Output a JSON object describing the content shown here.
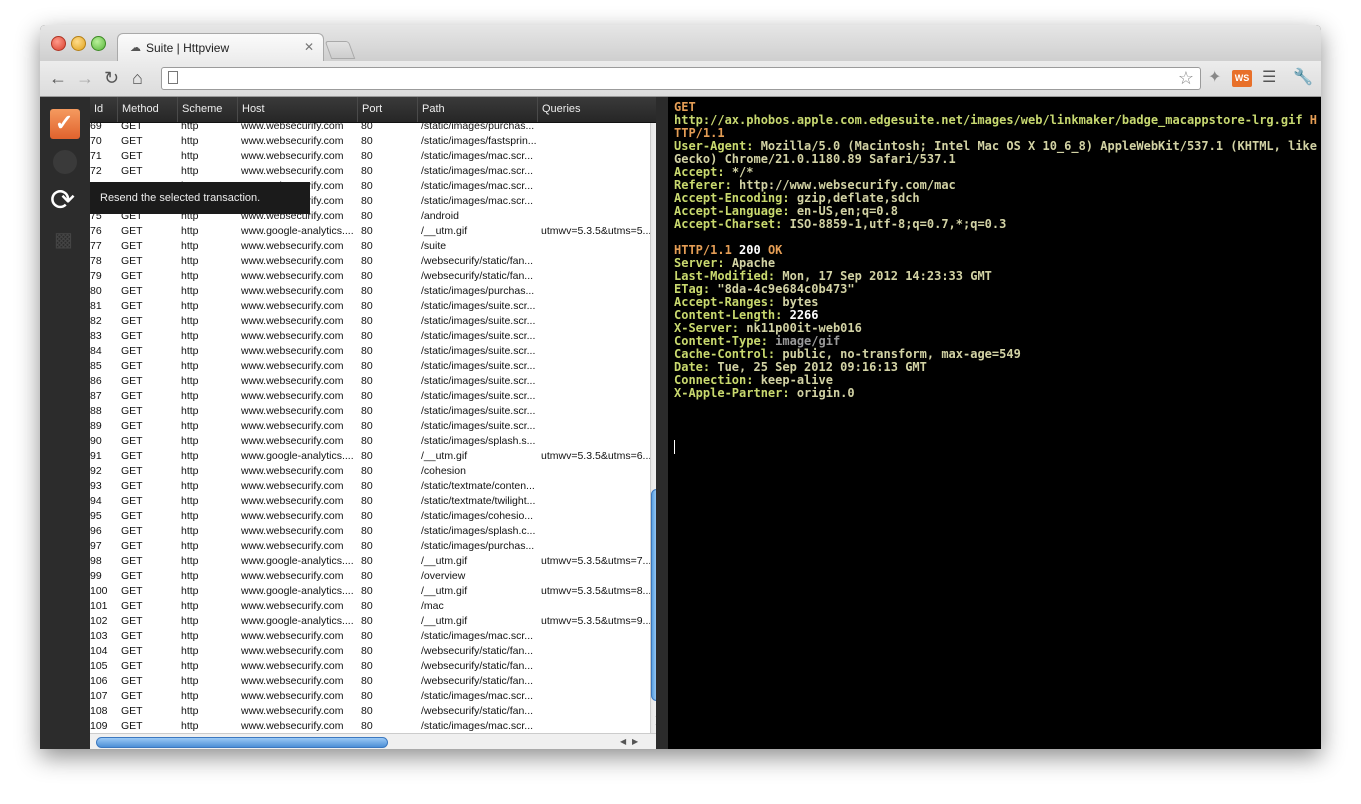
{
  "browser": {
    "tab_title": "Suite | Httpview",
    "tab_close": "✕",
    "url": "",
    "ext_ws_label": "WS"
  },
  "tooltip": "Resend the selected transaction.",
  "grid": {
    "columns": [
      "Id",
      "Method",
      "Scheme",
      "Host",
      "Port",
      "Path",
      "Queries"
    ],
    "rows": [
      [
        "69",
        "GET",
        "http",
        "www.websecurify.com",
        "80",
        "/static/images/purchas...",
        ""
      ],
      [
        "70",
        "GET",
        "http",
        "www.websecurify.com",
        "80",
        "/static/images/fastsprin...",
        ""
      ],
      [
        "71",
        "GET",
        "http",
        "www.websecurify.com",
        "80",
        "/static/images/mac.scr...",
        ""
      ],
      [
        "72",
        "GET",
        "http",
        "www.websecurify.com",
        "80",
        "/static/images/mac.scr...",
        ""
      ],
      [
        "73",
        "GET",
        "http",
        "www.websecurify.com",
        "80",
        "/static/images/mac.scr...",
        ""
      ],
      [
        "74",
        "GET",
        "http",
        "www.websecurify.com",
        "80",
        "/static/images/mac.scr...",
        ""
      ],
      [
        "75",
        "GET",
        "http",
        "www.websecurify.com",
        "80",
        "/android",
        ""
      ],
      [
        "76",
        "GET",
        "http",
        "www.google-analytics....",
        "80",
        "/__utm.gif",
        "utmwv=5.3.5&utms=5..."
      ],
      [
        "77",
        "GET",
        "http",
        "www.websecurify.com",
        "80",
        "/suite",
        ""
      ],
      [
        "78",
        "GET",
        "http",
        "www.websecurify.com",
        "80",
        "/websecurify/static/fan...",
        ""
      ],
      [
        "79",
        "GET",
        "http",
        "www.websecurify.com",
        "80",
        "/websecurify/static/fan...",
        ""
      ],
      [
        "80",
        "GET",
        "http",
        "www.websecurify.com",
        "80",
        "/static/images/purchas...",
        ""
      ],
      [
        "81",
        "GET",
        "http",
        "www.websecurify.com",
        "80",
        "/static/images/suite.scr...",
        ""
      ],
      [
        "82",
        "GET",
        "http",
        "www.websecurify.com",
        "80",
        "/static/images/suite.scr...",
        ""
      ],
      [
        "83",
        "GET",
        "http",
        "www.websecurify.com",
        "80",
        "/static/images/suite.scr...",
        ""
      ],
      [
        "84",
        "GET",
        "http",
        "www.websecurify.com",
        "80",
        "/static/images/suite.scr...",
        ""
      ],
      [
        "85",
        "GET",
        "http",
        "www.websecurify.com",
        "80",
        "/static/images/suite.scr...",
        ""
      ],
      [
        "86",
        "GET",
        "http",
        "www.websecurify.com",
        "80",
        "/static/images/suite.scr...",
        ""
      ],
      [
        "87",
        "GET",
        "http",
        "www.websecurify.com",
        "80",
        "/static/images/suite.scr...",
        ""
      ],
      [
        "88",
        "GET",
        "http",
        "www.websecurify.com",
        "80",
        "/static/images/suite.scr...",
        ""
      ],
      [
        "89",
        "GET",
        "http",
        "www.websecurify.com",
        "80",
        "/static/images/suite.scr...",
        ""
      ],
      [
        "90",
        "GET",
        "http",
        "www.websecurify.com",
        "80",
        "/static/images/splash.s...",
        ""
      ],
      [
        "91",
        "GET",
        "http",
        "www.google-analytics....",
        "80",
        "/__utm.gif",
        "utmwv=5.3.5&utms=6..."
      ],
      [
        "92",
        "GET",
        "http",
        "www.websecurify.com",
        "80",
        "/cohesion",
        ""
      ],
      [
        "93",
        "GET",
        "http",
        "www.websecurify.com",
        "80",
        "/static/textmate/conten...",
        ""
      ],
      [
        "94",
        "GET",
        "http",
        "www.websecurify.com",
        "80",
        "/static/textmate/twilight...",
        ""
      ],
      [
        "95",
        "GET",
        "http",
        "www.websecurify.com",
        "80",
        "/static/images/cohesio...",
        ""
      ],
      [
        "96",
        "GET",
        "http",
        "www.websecurify.com",
        "80",
        "/static/images/splash.c...",
        ""
      ],
      [
        "97",
        "GET",
        "http",
        "www.websecurify.com",
        "80",
        "/static/images/purchas...",
        ""
      ],
      [
        "98",
        "GET",
        "http",
        "www.google-analytics....",
        "80",
        "/__utm.gif",
        "utmwv=5.3.5&utms=7..."
      ],
      [
        "99",
        "GET",
        "http",
        "www.websecurify.com",
        "80",
        "/overview",
        ""
      ],
      [
        "100",
        "GET",
        "http",
        "www.google-analytics....",
        "80",
        "/__utm.gif",
        "utmwv=5.3.5&utms=8..."
      ],
      [
        "101",
        "GET",
        "http",
        "www.websecurify.com",
        "80",
        "/mac",
        ""
      ],
      [
        "102",
        "GET",
        "http",
        "www.google-analytics....",
        "80",
        "/__utm.gif",
        "utmwv=5.3.5&utms=9..."
      ],
      [
        "103",
        "GET",
        "http",
        "www.websecurify.com",
        "80",
        "/static/images/mac.scr...",
        ""
      ],
      [
        "104",
        "GET",
        "http",
        "www.websecurify.com",
        "80",
        "/websecurify/static/fan...",
        ""
      ],
      [
        "105",
        "GET",
        "http",
        "www.websecurify.com",
        "80",
        "/websecurify/static/fan...",
        ""
      ],
      [
        "106",
        "GET",
        "http",
        "www.websecurify.com",
        "80",
        "/websecurify/static/fan...",
        ""
      ],
      [
        "107",
        "GET",
        "http",
        "www.websecurify.com",
        "80",
        "/static/images/mac.scr...",
        ""
      ],
      [
        "108",
        "GET",
        "http",
        "www.websecurify.com",
        "80",
        "/websecurify/static/fan...",
        ""
      ],
      [
        "109",
        "GET",
        "http",
        "www.websecurify.com",
        "80",
        "/static/images/mac.scr...",
        ""
      ]
    ]
  },
  "request": {
    "method": "GET",
    "target": "http://ax.phobos.apple.com.edgesuite.net/images/web/linkmaker/badge_macappstore-lrg.gif",
    "protocol": "HTTP/1.1",
    "headers": [
      {
        "name": "User-Agent",
        "value": "Mozilla/5.0 (Macintosh; Intel Mac OS X 10_6_8) AppleWebKit/537.1 (KHTML, like Gecko) Chrome/21.0.1180.89 Safari/537.1"
      },
      {
        "name": "Accept",
        "value": "*/*"
      },
      {
        "name": "Referer",
        "value": "http://www.websecurify.com/mac"
      },
      {
        "name": "Accept-Encoding",
        "value": "gzip,deflate,sdch"
      },
      {
        "name": "Accept-Language",
        "value": "en-US,en;q=0.8"
      },
      {
        "name": "Accept-Charset",
        "value": "ISO-8859-1,utf-8;q=0.7,*;q=0.3"
      }
    ]
  },
  "response": {
    "protocol": "HTTP/1.1",
    "status_code": "200",
    "status_text": "OK",
    "headers": [
      {
        "name": "Server",
        "value": "Apache"
      },
      {
        "name": "Last-Modified",
        "value": "Mon, 17 Sep 2012 14:23:33 GMT"
      },
      {
        "name": "ETag",
        "value": "\"8da-4c9e684c0b473\""
      },
      {
        "name": "Accept-Ranges",
        "value": "bytes"
      },
      {
        "name": "Content-Length",
        "value": "2266"
      },
      {
        "name": "X-Server",
        "value": "nk11p00it-web016"
      },
      {
        "name": "Content-Type",
        "value": "image/gif"
      },
      {
        "name": "Cache-Control",
        "value": "public, no-transform, max-age=549"
      },
      {
        "name": "Date",
        "value": "Tue, 25 Sep 2012 09:16:13 GMT"
      },
      {
        "name": "Connection",
        "value": "keep-alive"
      },
      {
        "name": "X-Apple-Partner",
        "value": "origin.0"
      }
    ]
  },
  "colors": {
    "accent": "#e0622d",
    "method": "#e49d55",
    "header": "#c9d96e",
    "scroll_thumb": "#5aa0e0"
  },
  "icons": {
    "suite": "check-box-icon",
    "play": "play-icon",
    "resend": "refresh-icon",
    "paint": "paint-roller-icon"
  }
}
